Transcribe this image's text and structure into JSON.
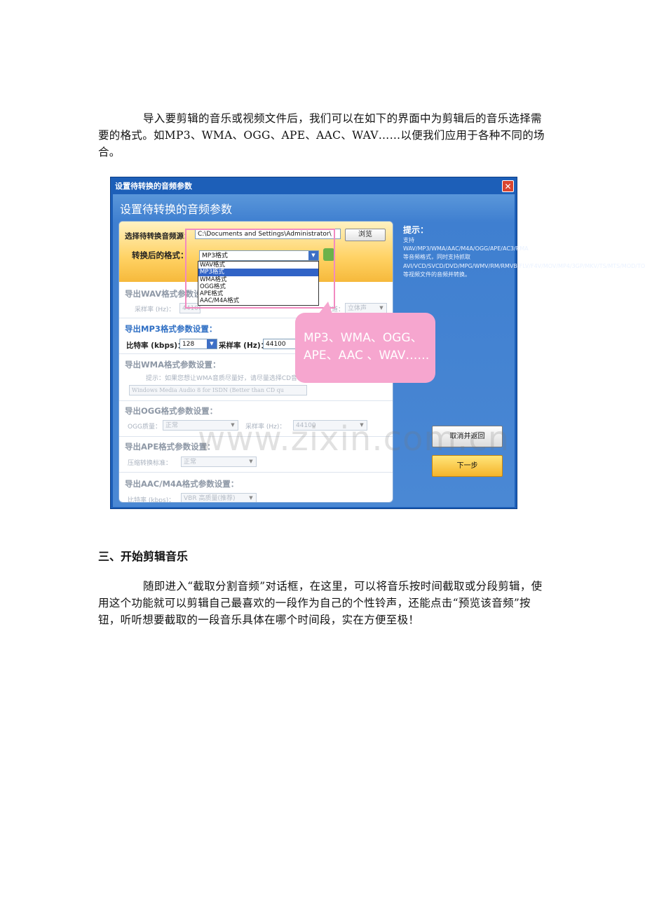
{
  "intro": "导入要剪辑的音乐或视频文件后，我们可以在如下的界面中为剪辑后的音乐选择需要的格式。如MP3、WMA、OGG、APE、AAC、WAV……以便我们应用于各种不同的场合。",
  "dialog": {
    "title": "设置待转换的音频参数",
    "heading": "设置待转换的音频参数",
    "close": "✕",
    "source_label": "选择待转换音频源：",
    "source_path": "C:\\Documents and Settings\\Administrator\\",
    "browse": "浏览",
    "format_label": "转换后的格式：",
    "format_value": "MP3格式",
    "format_options": [
      "WAV格式",
      "MP3格式",
      "WMA格式",
      "OGG格式",
      "APE格式",
      "AAC/M4A格式"
    ],
    "selected_option_index": 1,
    "wav": {
      "heading": "导出WAV格式参数设置：",
      "rate_label": "采样率 (Hz)：",
      "rate_value": "44100",
      "channel_label": "声道：",
      "channel_value": "立体声"
    },
    "mp3": {
      "heading": "导出MP3格式参数设置：",
      "bitrate_label": "比特率 (kbps)：",
      "bitrate_value": "128",
      "rate_label": "采样率 (Hz)：",
      "rate_value": "44100"
    },
    "wma": {
      "heading": "导出WMA格式参数设置：",
      "tip": "提示：如果您想让WMA音质尽量好，请尽量选择CD音",
      "profile_value": "Windows Media Audio 8 for ISDN (Better than CD qu"
    },
    "ogg": {
      "heading": "导出OGG格式参数设置：",
      "quality_label": "OGG质量：",
      "quality_value": "正常",
      "rate_label": "采样率 (Hz)：",
      "rate_value": "44100"
    },
    "ape": {
      "heading": "导出APE格式参数设置：",
      "level_label": "压缩转换标准：",
      "level_value": "正常"
    },
    "aac": {
      "heading": "导出AAC/M4A格式参数设置：",
      "bitrate_label": "比特率 (kbps)：",
      "bitrate_value": "VBR 高质量(推荐)"
    },
    "tip_title": "提示：",
    "tip_text": "支持WAV/MP3/WMA/AAC/M4A/OGG/APE/AC3/RMA等音频格式，同时支持抓取AVI/VCD/SVCD/DVD/MPG/WMV/RM/RMVB/FLV/F4V/MOV/MP4/3GP/MKV/TS/MTS/MOD/TOD等视频文件的音频并转换。",
    "cancel": "取消并返回",
    "next": "下一步"
  },
  "callout": "MP3、WMA、OGG、APE、AAC 、WAV……",
  "watermark": "www.zixin.com.cn",
  "section_heading": "三、开始剪辑音乐",
  "body2": "随即进入“截取分割音频”对话框，在这里，可以将音乐按时间截取或分段剪辑，使用这个功能就可以剪辑自己最喜欢的一段作为自己的个性铃声，还能点击“预览该音频”按钮，听听想要截取的一段音乐具体在哪个时间段，实在方便至极！"
}
